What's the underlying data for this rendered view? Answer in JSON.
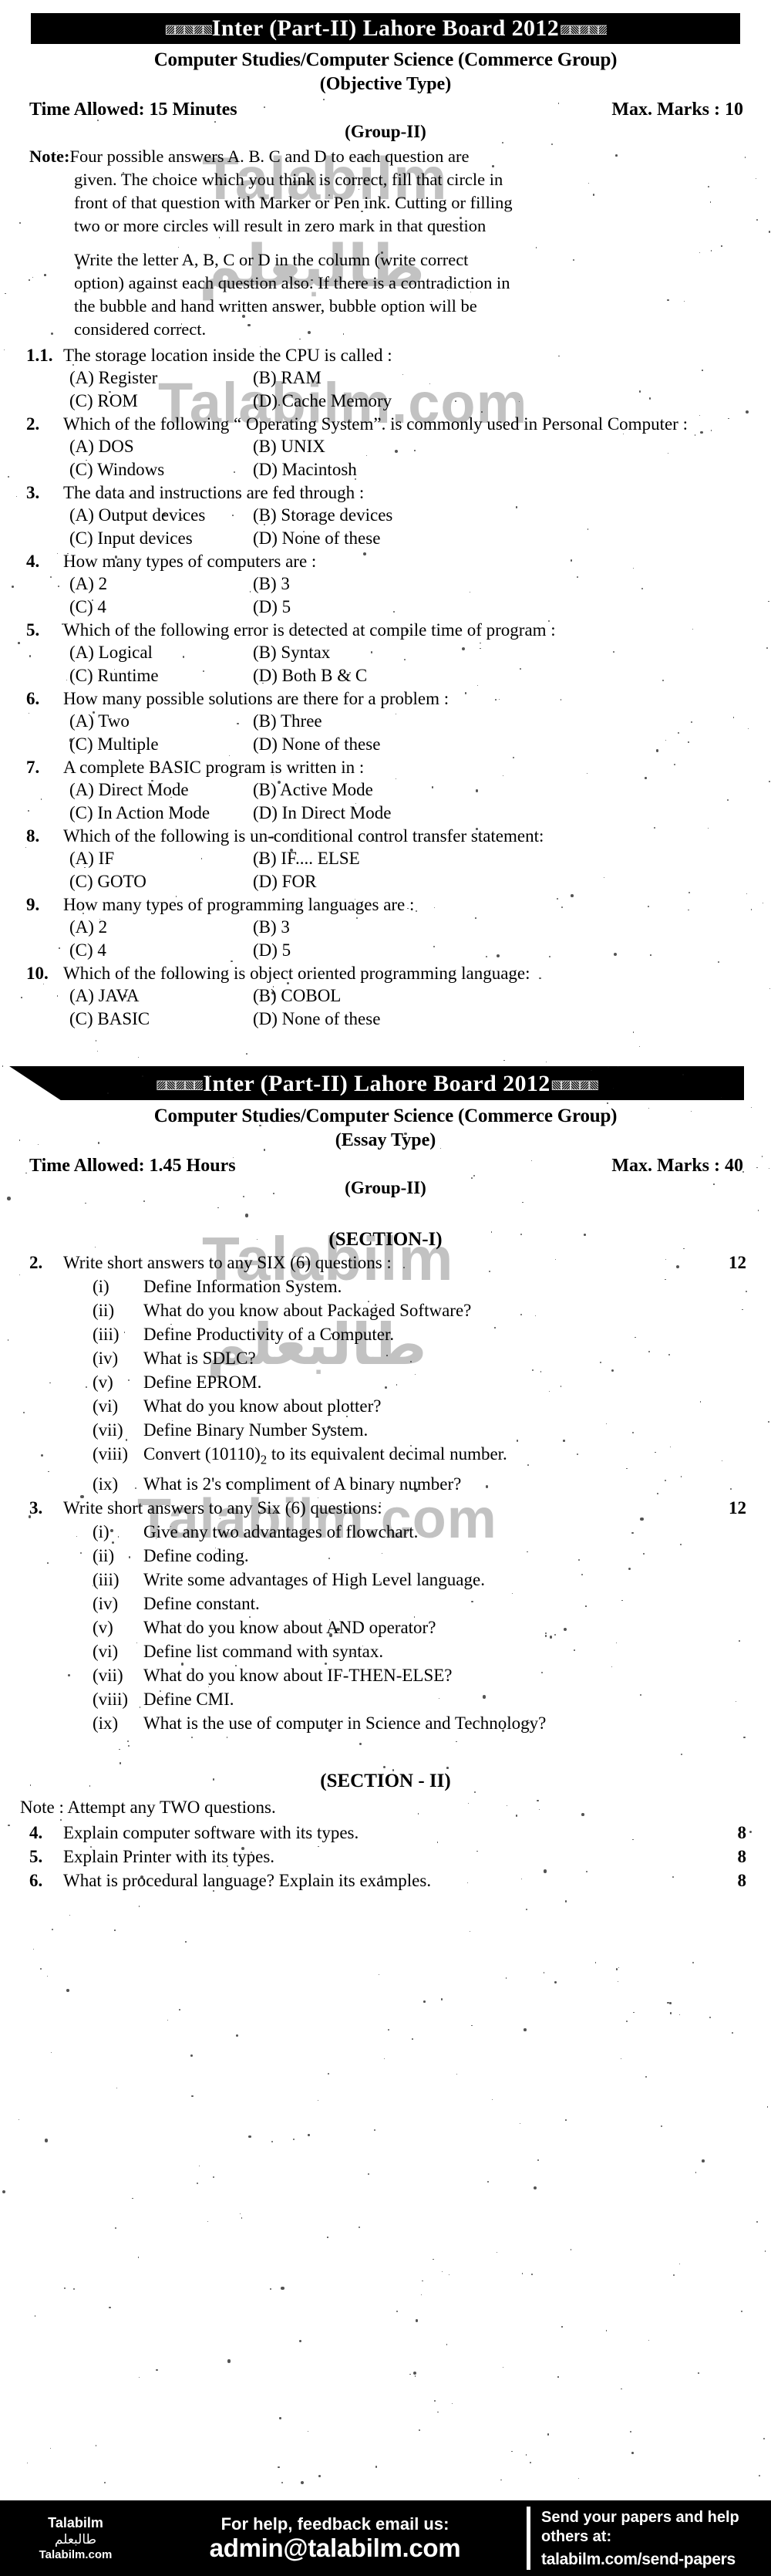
{
  "objective": {
    "banner_title": "Inter (Part-II) Lahore Board 2012",
    "subject": "Computer Studies/Computer Science (Commerce Group)",
    "paper_type": "(Objective Type)",
    "time_allowed": "Time Allowed: 15 Minutes",
    "max_marks": "Max. Marks : 10",
    "group": "(Group-II)",
    "note_label": "Note:",
    "note_line1": "Four possible answers A. B. C and D to each question are",
    "note_line2": "given. The choice which you think is correct, fill that circle in",
    "note_line3": "front of that question with Marker or Pen ink. Cutting or filling",
    "note_line4": "two or more circles will result in zero mark in that question",
    "note_line5": "Write the letter A, B, C or D in the column (write correct",
    "note_line6": "option) against each question also. If there is a contradiction in",
    "note_line7": "the bubble and hand written answer, bubble option will be",
    "note_line8": "considered correct.",
    "questions": [
      {
        "num": "1.1.",
        "stem": "The storage location inside the CPU is called :",
        "a": "(A) Register",
        "b": "(B) RAM",
        "c": "(C) ROM",
        "d": "(D) Cache Memory"
      },
      {
        "num": "2.",
        "stem": "Which of the following “ Operating System”. is commonly used in Personal Computer :",
        "a": "(A) DOS",
        "b": "(B) UNIX",
        "c": "(C) Windows",
        "d": "(D) Macintosh"
      },
      {
        "num": "3.",
        "stem": "The data and instructions are fed through :",
        "a": "(A) Output devices",
        "b": "(B) Storage devices",
        "c": "(C) Input devices",
        "d": "(D) None of these"
      },
      {
        "num": "4.",
        "stem": "How many types of computers are :",
        "a": "(A) 2",
        "b": "(B) 3",
        "c": "(C) 4",
        "d": "(D) 5"
      },
      {
        "num": "5.",
        "stem": "Which of the following error is detected at compile time of program :",
        "a": "(A) Logical",
        "b": "(B) Syntax",
        "c": "(C) Runtime",
        "d": "(D) Both B & C"
      },
      {
        "num": "6.",
        "stem": "How many possible solutions are there for a problem :",
        "a": "(A) Two",
        "b": "(B) Three",
        "c": "(C) Multiple",
        "d": "(D) None of these"
      },
      {
        "num": "7.",
        "stem": "A complete BASIC program is written in :",
        "a": "(A) Direct Mode",
        "b": "(B) Active Mode",
        "c": "(C) In Action Mode",
        "d": "(D) In Direct Mode"
      },
      {
        "num": "8.",
        "stem": "Which of the following is un-conditional control transfer statement:",
        "a": "(A) IF",
        "b": "(B) IF.... ELSE",
        "c": "(C) GOTO",
        "d": "(D) FOR"
      },
      {
        "num": "9.",
        "stem": "How many types of programming languages are :",
        "a": "(A) 2",
        "b": "(B) 3",
        "c": "(C) 4",
        "d": "(D) 5"
      },
      {
        "num": "10.",
        "stem": "Which of the following is object oriented programming language:",
        "a": "(A) JAVA",
        "b": "(B) COBOL",
        "c": "(C) BASIC",
        "d": "(D) None of these"
      }
    ]
  },
  "essay": {
    "banner_title": "Inter (Part-II) Lahore Board 2012",
    "subject": "Computer Studies/Computer Science (Commerce Group)",
    "paper_type": "(Essay Type)",
    "time_allowed": "Time Allowed: 1.45 Hours",
    "max_marks": "Max. Marks : 40",
    "group": "(Group-II)",
    "section1_title": "(SECTION-I)",
    "q2": {
      "num": "2.",
      "text": "Write short answers to any SIX (6) questions :",
      "marks": "12",
      "items": [
        {
          "rn": "(i)",
          "text": "Define Information System."
        },
        {
          "rn": "(ii)",
          "text": "What do you know about Packaged Software?"
        },
        {
          "rn": "(iii)",
          "text": "Define Productivity of a Computer."
        },
        {
          "rn": "(iv)",
          "text": "What is SDLC?"
        },
        {
          "rn": "(v)",
          "text": "Define EPROM."
        },
        {
          "rn": "(vi)",
          "text": "What do you know about plotter?"
        },
        {
          "rn": "(vii)",
          "text": "Define Binary Number System."
        },
        {
          "rn": "(viii)",
          "text": "Convert (10110)2 to its equivalent decimal number.",
          "pre": "Convert (10110)",
          "sub": "2",
          "post": " to its equivalent decimal number."
        },
        {
          "rn": "(ix)",
          "text": "What is 2's compliment of A binary number?"
        }
      ]
    },
    "q3": {
      "num": "3.",
      "text": "Write short answers to any Six (6) questions:",
      "marks": "12",
      "items": [
        {
          "rn": "(i)",
          "text": "Give any two advantages of flowchart."
        },
        {
          "rn": "(ii)",
          "text": "Define coding."
        },
        {
          "rn": "(iii)",
          "text": "Write some advantages of High Level language."
        },
        {
          "rn": "(iv)",
          "text": "Define constant."
        },
        {
          "rn": "(v)",
          "text": "What do you know about AND operator?"
        },
        {
          "rn": "(vi)",
          "text": "Define list command with syntax."
        },
        {
          "rn": "(vii)",
          "text": "What do you know about IF-THEN-ELSE?"
        },
        {
          "rn": "(viii)",
          "text": "Define CMI."
        },
        {
          "rn": "(ix)",
          "text": "What is the use of computer in Science and Technology?"
        }
      ]
    },
    "section2_title": "(SECTION - II)",
    "section2_note": "Note : Attempt any TWO questions.",
    "long_questions": [
      {
        "num": "4.",
        "text": "Explain computer software with its types.",
        "marks": "8"
      },
      {
        "num": "5.",
        "text": "Explain Printer with its types.",
        "marks": "8"
      },
      {
        "num": "6.",
        "text": "What is procedural language? Explain its examples.",
        "marks": "8"
      }
    ]
  },
  "watermarks": {
    "w1": "Talabilm",
    "w2": "طالبعلم",
    "w3": "Talabilm.com",
    "w4": "Talabilm",
    "w5": "طالبعلم",
    "w6": "Talabilm.com"
  },
  "footer": {
    "brand_name": "Talabilm",
    "brand_urdu": "طالبعلم",
    "brand_site": "Talabilm.com",
    "help_text": "For help, feedback email us:",
    "email": "admin@talabilm.com",
    "send_text_line1": "Send your papers and help",
    "send_text_line2": "others at:",
    "send_url": "talabilm.com/send-papers"
  }
}
